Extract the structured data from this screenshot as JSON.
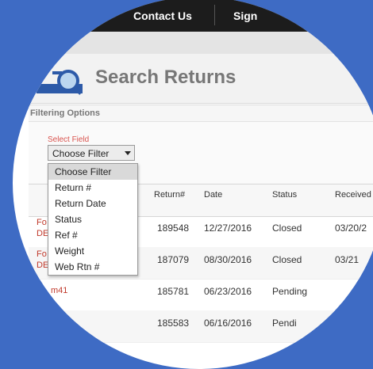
{
  "nav": {
    "contact": "Contact Us",
    "sign": "Sign"
  },
  "page": {
    "title": "Search Returns"
  },
  "filtering": {
    "section_label": "Filtering Options",
    "select_label": "Select Field",
    "selected": "Choose Filter",
    "options": [
      "Choose Filter",
      "Return #",
      "Return Date",
      "Status",
      "Ref #",
      "Weight",
      "Web Rtn #"
    ]
  },
  "table": {
    "headers": {
      "return_no": "Return#",
      "date": "Date",
      "status": "Status",
      "received": "Received"
    },
    "rows": [
      {
        "link": "Fo\nDE",
        "return_no": "189548",
        "date": "12/27/2016",
        "status": "Closed",
        "received": "03/20/2"
      },
      {
        "link": "Fo\nDE",
        "return_no": "187079",
        "date": "08/30/2016",
        "status": "Closed",
        "received": "03/21"
      },
      {
        "link": "m41",
        "return_no": "185781",
        "date": "06/23/2016",
        "status": "Pending",
        "received": ""
      },
      {
        "link": "",
        "return_no": "185583",
        "date": "06/16/2016",
        "status": "Pendi",
        "received": ""
      }
    ]
  },
  "colors": {
    "background": "#3e6bc4",
    "nav": "#1c1c1c",
    "link": "#c0392b",
    "accent_label": "#d9544f"
  },
  "icons": {
    "title_icon": "magnifier-icon"
  }
}
